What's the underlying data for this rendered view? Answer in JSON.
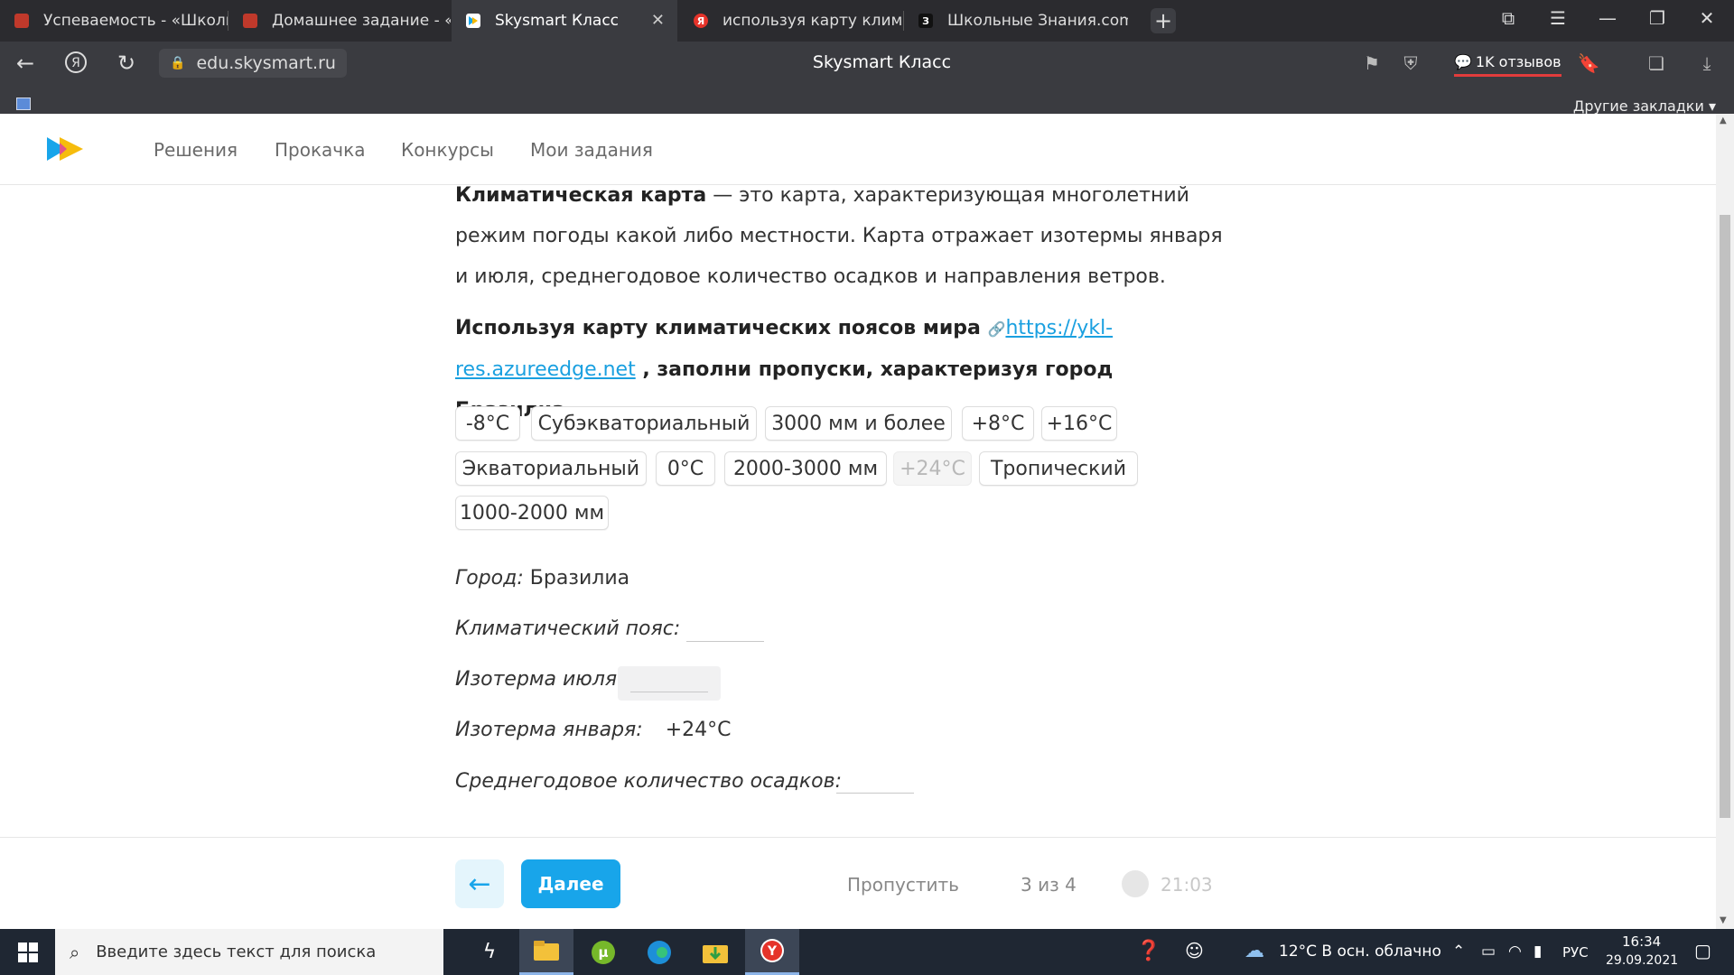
{
  "browser": {
    "tabs": [
      {
        "title": "Успеваемость - «Школьн",
        "favicon_color": "#c0392b",
        "active": false
      },
      {
        "title": "Домашнее задание - «Шк",
        "favicon_color": "#c0392b",
        "active": false
      },
      {
        "title": "Skysmart Класс",
        "favicon_color": "#ffffff",
        "active": true
      },
      {
        "title": "используя карту климатич",
        "favicon_color": "#e5332a",
        "favicon_letter": "Я",
        "active": false
      },
      {
        "title": "Школьные Знания.com - Г",
        "favicon_color": "#111111",
        "favicon_letter": "З",
        "active": false
      }
    ],
    "url": "edu.skysmart.ru",
    "page_title": "Skysmart Класс",
    "reviews": "1K отзывов",
    "other_bookmarks": "Другие закладки"
  },
  "site": {
    "nav": [
      "Решения",
      "Прокачка",
      "Конкурсы",
      "Мои задания"
    ]
  },
  "content": {
    "definition_term": "Климатическая карта",
    "definition_text": " — это карта, характеризующая многолетний режим погоды какой либо местности. Карта отражает изотермы января и июля, среднегодовое количество осадков и направления ветров.",
    "task_prefix": "Используя карту климатических поясов мира ",
    "task_link": "https://ykl-res.azureedge.net",
    "task_suffix": " , заполни пропуски, характеризуя город Бразилиа.",
    "chips": [
      "-8°C",
      "Субэкваториальный",
      "3000 мм и более",
      "+8°C",
      "+16°C",
      "Экваториальный",
      "0°C",
      "2000-3000 мм",
      "+24°C",
      "Тропический",
      "1000-2000 мм"
    ],
    "fields": {
      "city_label": "Город:",
      "city_value": "Бразилиа",
      "belt_label": "Климатический пояс:",
      "july_label": "Изотерма июля:",
      "jan_label": "Изотерма января:",
      "jan_value": "+24°C",
      "precip_label": "Среднегодовое количество осадков:"
    }
  },
  "footer": {
    "next": "Далее",
    "skip": "Пропустить",
    "progress": "3 из 4",
    "timer": "21:03"
  },
  "taskbar": {
    "search_placeholder": "Введите здесь текст для поиска",
    "weather": "12°C  В осн. облачно",
    "lang": "РУС",
    "time": "16:34",
    "date": "29.09.2021"
  }
}
